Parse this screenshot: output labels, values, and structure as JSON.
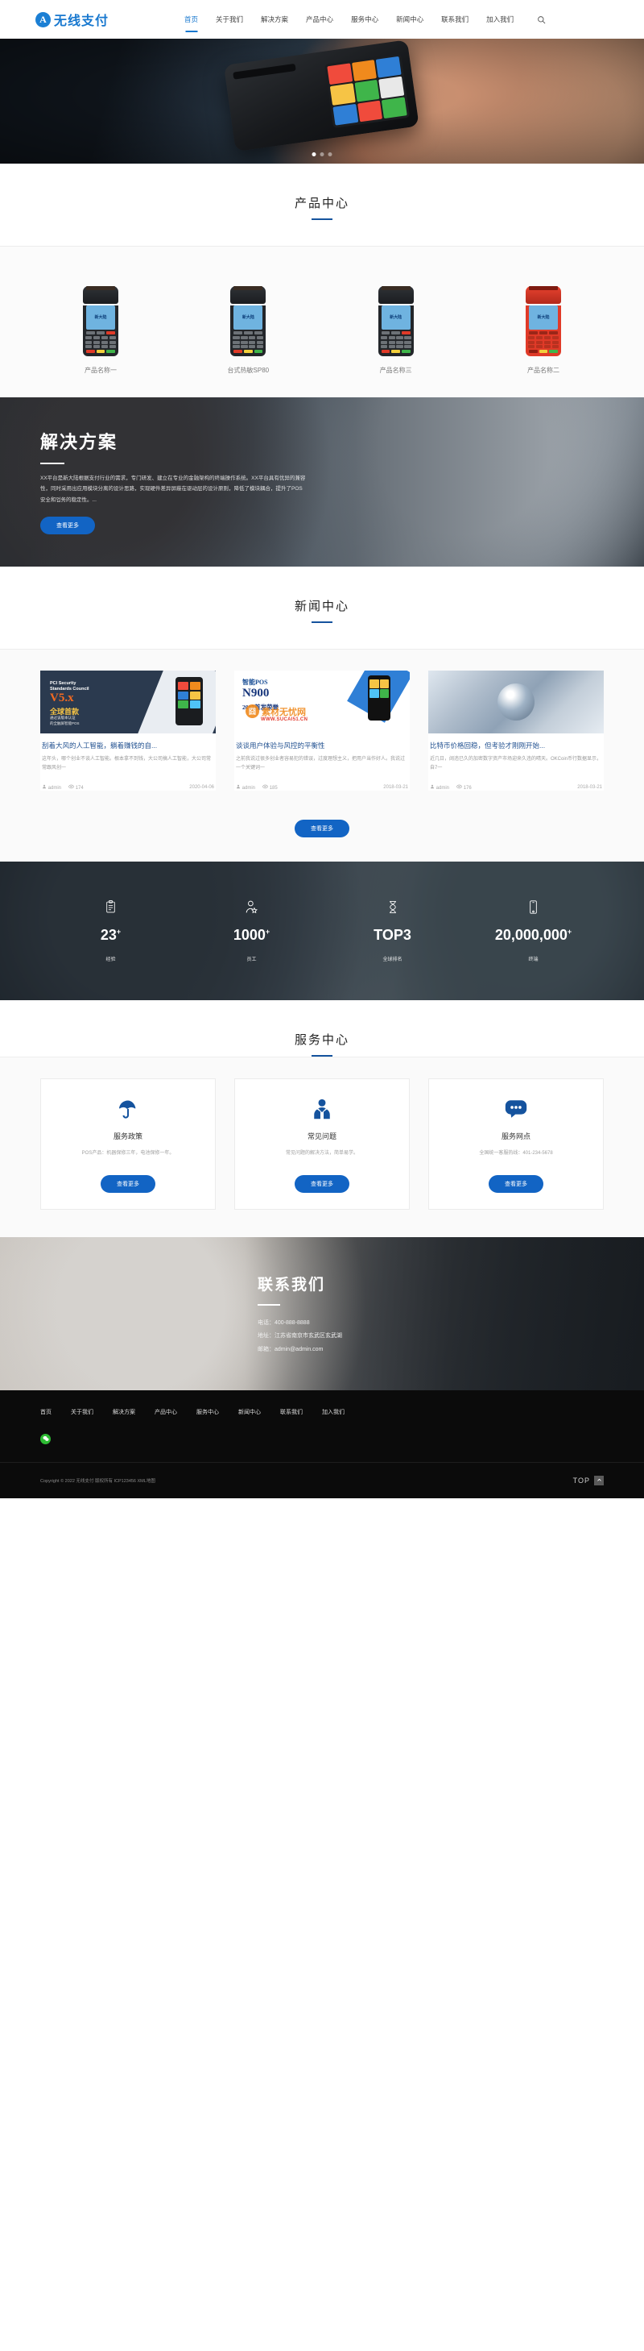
{
  "header": {
    "logo_text": "无线支付",
    "logo_mark": "A",
    "nav": [
      {
        "label": "首页",
        "active": true
      },
      {
        "label": "关于我们",
        "active": false
      },
      {
        "label": "解决方案",
        "active": false
      },
      {
        "label": "产品中心",
        "active": false
      },
      {
        "label": "服务中心",
        "active": false
      },
      {
        "label": "新闻中心",
        "active": false
      },
      {
        "label": "联系我们",
        "active": false
      },
      {
        "label": "加入我们",
        "active": false
      }
    ],
    "search_icon": "search-icon"
  },
  "hero": {
    "slides": 3,
    "active_slide": 0
  },
  "products": {
    "title": "产品中心",
    "items": [
      {
        "name": "产品名称一",
        "color": "black"
      },
      {
        "name": "台式热敏SP80",
        "color": "black"
      },
      {
        "name": "产品名称三",
        "color": "black"
      },
      {
        "name": "产品名称二",
        "color": "red"
      }
    ]
  },
  "solution": {
    "title": "解决方案",
    "paragraph": "XX平台是新大陆根据支付行业的需求，专门研发、建立在专业的金融架构的终端操作系统。XX平台具有优异的兼容性，同时采用出应用模块分离的设计思路，实现硬件差异屏蔽在驱动层的设计原则，降低了模块耦合，提升了POS安全和업务的稳定性。...",
    "button": "查看更多"
  },
  "news": {
    "title": "新闻中心",
    "more_button": "查看更多",
    "items": [
      {
        "title": "刮着大风的人工智能，躺着赚钱的自...",
        "desc": "这年头，哪个创业不谈人工智能。根本拿不到钱，大公司搞人工智能，大公司常常跟风创一",
        "author": "admin",
        "views": "174",
        "date": "2020-04-06",
        "art": {
          "line1": "PCI Security",
          "line2": "Standards Council",
          "version": "V5.x",
          "headline": "全球首款",
          "sub1": "通过该版本认证",
          "sub2": "的全触屏智能POS"
        }
      },
      {
        "title": "谈谈用户体验与风控的平衡性",
        "desc": "之前我说过很多创业者容易犯的错误，过度理想主义，把用户当作好人。我说过一个关键词一",
        "author": "admin",
        "views": "185",
        "date": "2018-03-21",
        "art": {
          "h1": "智能POS",
          "h2": "N900",
          "h3": "2017首发荣誉",
          "watermark_mark": "囧",
          "watermark_text": "素材无忧网",
          "watermark_url": "WWW.SUCAI51.CN"
        }
      },
      {
        "title": "比特币价格回稳，但考验才刚刚开始...",
        "desc": "近几日，阔违已久的加密数字资产市场迎来久违的晴天。OKCoin币行数据显示，自7一",
        "author": "admin",
        "views": "176",
        "date": "2018-03-21",
        "art": {
          "image": "globe-network"
        }
      }
    ]
  },
  "stats": [
    {
      "icon": "clipboard-icon",
      "value": "23",
      "sup": "+",
      "label": "经验"
    },
    {
      "icon": "user-star-icon",
      "value": "1000",
      "sup": "+",
      "label": "员工"
    },
    {
      "icon": "medal-icon",
      "value": "TOP3",
      "sup": "",
      "label": "全球排名"
    },
    {
      "icon": "terminal-icon",
      "value": "20,000,000",
      "sup": "+",
      "label": "终端"
    }
  ],
  "service": {
    "title": "服务中心",
    "items": [
      {
        "icon": "umbrella-icon",
        "title": "服务政策",
        "desc": "POS产品：机器保修三年，电池保修一年。",
        "button": "查看更多"
      },
      {
        "icon": "support-agent-icon",
        "title": "常见问题",
        "desc": "常见问题的解决方法，简单易学。",
        "button": "查看更多"
      },
      {
        "icon": "chat-bubble-icon",
        "title": "服务网点",
        "desc": "全国统一客服热线：401-234-5678",
        "button": "查看更多"
      }
    ]
  },
  "contact": {
    "title": "联系我们",
    "phone": "电话：400-888-8888",
    "address": "地址：江苏省南京市玄武区玄武湖",
    "email": "邮箱：admin@admin.com"
  },
  "footer": {
    "nav": [
      "首页",
      "关于我们",
      "解决方案",
      "产品中心",
      "服务中心",
      "新闻中心",
      "联系我们",
      "加入我们"
    ],
    "social": [
      "wechat-icon"
    ],
    "copyright": "Copyright © 2022 无线支付 版权所有 ICP123456 XML地图",
    "top_label": "TOP"
  },
  "colors": {
    "brand_blue": "#1878cf",
    "accent_blue": "#1264c4",
    "title_bar": "#15539e",
    "news_title": "#1f4f8f",
    "wechat_green": "#2dbb33"
  }
}
